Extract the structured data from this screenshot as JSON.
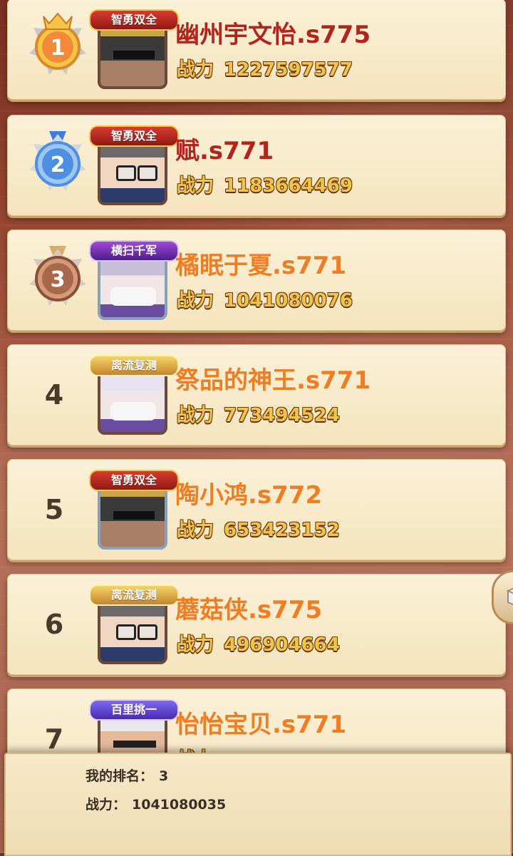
{
  "entries": [
    {
      "rank": "1",
      "title": "智勇双全",
      "name": "幽州宇文怡.s775",
      "power_label": "战力",
      "power": "1227597577",
      "name_color": "#b3241c"
    },
    {
      "rank": "2",
      "title": "智勇双全",
      "name": "赋.s771",
      "power_label": "战力",
      "power": "1183664469",
      "name_color": "#b3241c"
    },
    {
      "rank": "3",
      "title": "横扫千军",
      "name": "橘眠于夏.s771",
      "power_label": "战力",
      "power": "1041080076",
      "name_color": "#ef7d24"
    },
    {
      "rank": "4",
      "title": "离流复测",
      "name": "祭品的神王.s771",
      "power_label": "战力",
      "power": "773494524",
      "name_color": "#ef7d24"
    },
    {
      "rank": "5",
      "title": "智勇双全",
      "name": "陶小鸿.s772",
      "power_label": "战力",
      "power": "653423152",
      "name_color": "#ef7d24"
    },
    {
      "rank": "6",
      "title": "离流复测",
      "name": "蘑菇侠.s775",
      "power_label": "战力",
      "power": "496904664",
      "name_color": "#ef7d24"
    },
    {
      "rank": "7",
      "title": "百里挑一",
      "name": "怡怡宝贝.s771",
      "power_label": "战力",
      "power": "",
      "name_color": "#ef7d24"
    }
  ],
  "my_info": {
    "rank_label": "我的排名：",
    "rank_value": "3",
    "power_label": "战力：",
    "power_value": "1041080035"
  },
  "colors": {
    "gold_medal": "#f2b636",
    "silver_medal": "#4f8fe0",
    "bronze_medal": "#a8694a"
  }
}
